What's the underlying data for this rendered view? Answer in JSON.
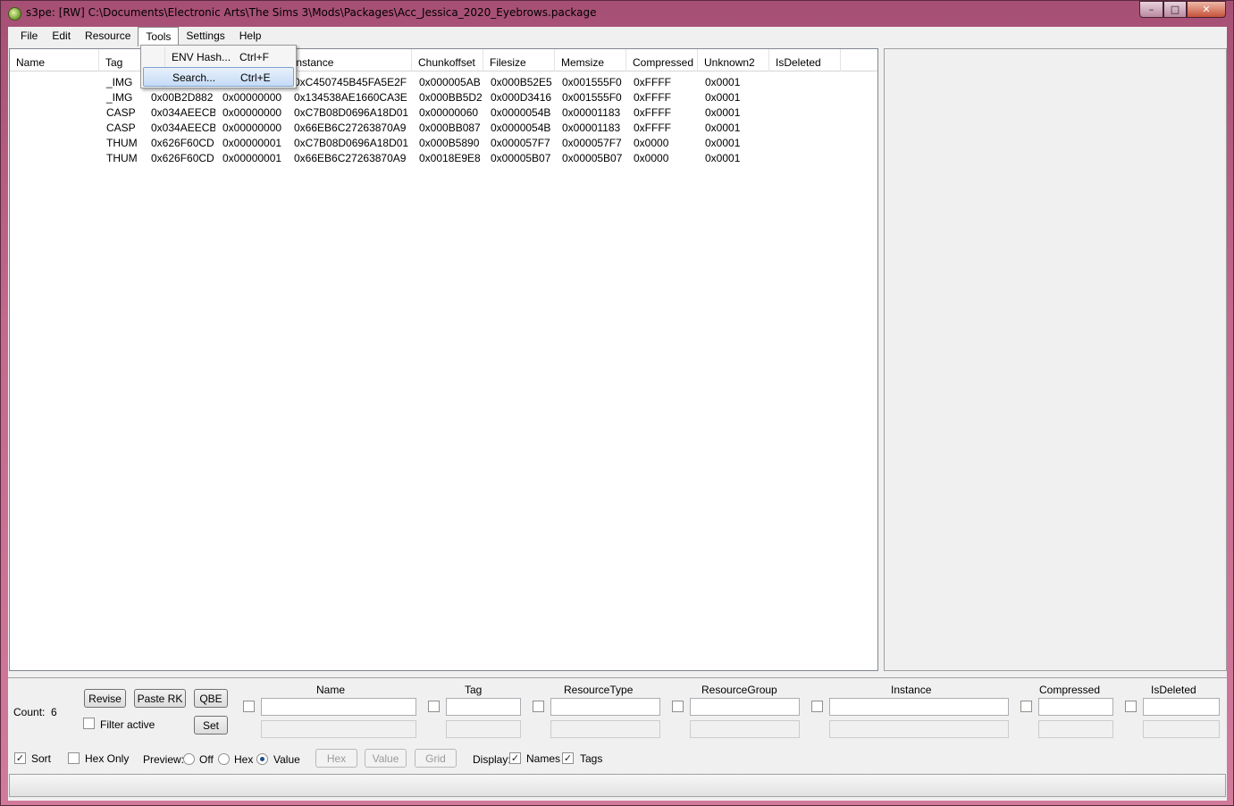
{
  "window": {
    "title": "s3pe: [RW] C:\\Documents\\Electronic Arts\\The Sims 3\\Mods\\Packages\\Acc_Jessica_2020_Eyebrows.package",
    "minimize": "–",
    "maximize": "□",
    "close": "✕"
  },
  "menu": [
    "File",
    "Edit",
    "Resource",
    "Tools",
    "Settings",
    "Help"
  ],
  "tools_menu": [
    {
      "label": "ENV Hash...",
      "shortcut": "Ctrl+F"
    },
    {
      "label": "Search...",
      "shortcut": "Ctrl+E"
    }
  ],
  "columns": [
    "Name",
    "Tag",
    "",
    "",
    "Instance",
    "Chunkoffset",
    "Filesize",
    "Memsize",
    "Compressed",
    "Unknown2",
    "IsDeleted"
  ],
  "rows": [
    [
      "",
      "_IMG",
      "",
      "",
      "0xC450745B45FA5E2F",
      "0x000005AB",
      "0x000B52E5",
      "0x001555F0",
      "0xFFFF",
      "0x0001",
      ""
    ],
    [
      "",
      "_IMG",
      "0x00B2D882",
      "0x00000000",
      "0x134538AE1660CA3E",
      "0x000BB5D2",
      "0x000D3416",
      "0x001555F0",
      "0xFFFF",
      "0x0001",
      ""
    ],
    [
      "",
      "CASP",
      "0x034AEECB",
      "0x00000000",
      "0xC7B08D0696A18D01",
      "0x00000060",
      "0x0000054B",
      "0x00001183",
      "0xFFFF",
      "0x0001",
      ""
    ],
    [
      "",
      "CASP",
      "0x034AEECB",
      "0x00000000",
      "0x66EB6C27263870A9",
      "0x000BB087",
      "0x0000054B",
      "0x00001183",
      "0xFFFF",
      "0x0001",
      ""
    ],
    [
      "",
      "THUM",
      "0x626F60CD",
      "0x00000001",
      "0xC7B08D0696A18D01",
      "0x000B5890",
      "0x000057F7",
      "0x000057F7",
      "0x0000",
      "0x0001",
      ""
    ],
    [
      "",
      "THUM",
      "0x626F60CD",
      "0x00000001",
      "0x66EB6C27263870A9",
      "0x0018E9E8",
      "0x00005B07",
      "0x00005B07",
      "0x0000",
      "0x0001",
      ""
    ]
  ],
  "bottom": {
    "count_label": "Count:",
    "count_value": "6",
    "revise": "Revise",
    "paste_rk": "Paste RK",
    "qbe": "QBE",
    "set": "Set",
    "filter_active": "Filter active",
    "filter_columns": [
      "Name",
      "Tag",
      "ResourceType",
      "ResourceGroup",
      "Instance",
      "Compressed",
      "IsDeleted"
    ],
    "sort": "Sort",
    "sort_checked": true,
    "hex_only": "Hex Only",
    "hex_only_checked": false,
    "preview_label": "Preview:",
    "preview_off": "Off",
    "preview_hex": "Hex",
    "preview_value": "Value",
    "preview_selected": "Value",
    "btn_hex": "Hex",
    "btn_value": "Value",
    "btn_grid": "Grid",
    "display_label": "Display:",
    "display_names": "Names",
    "display_names_checked": true,
    "display_tags": "Tags",
    "display_tags_checked": true
  }
}
